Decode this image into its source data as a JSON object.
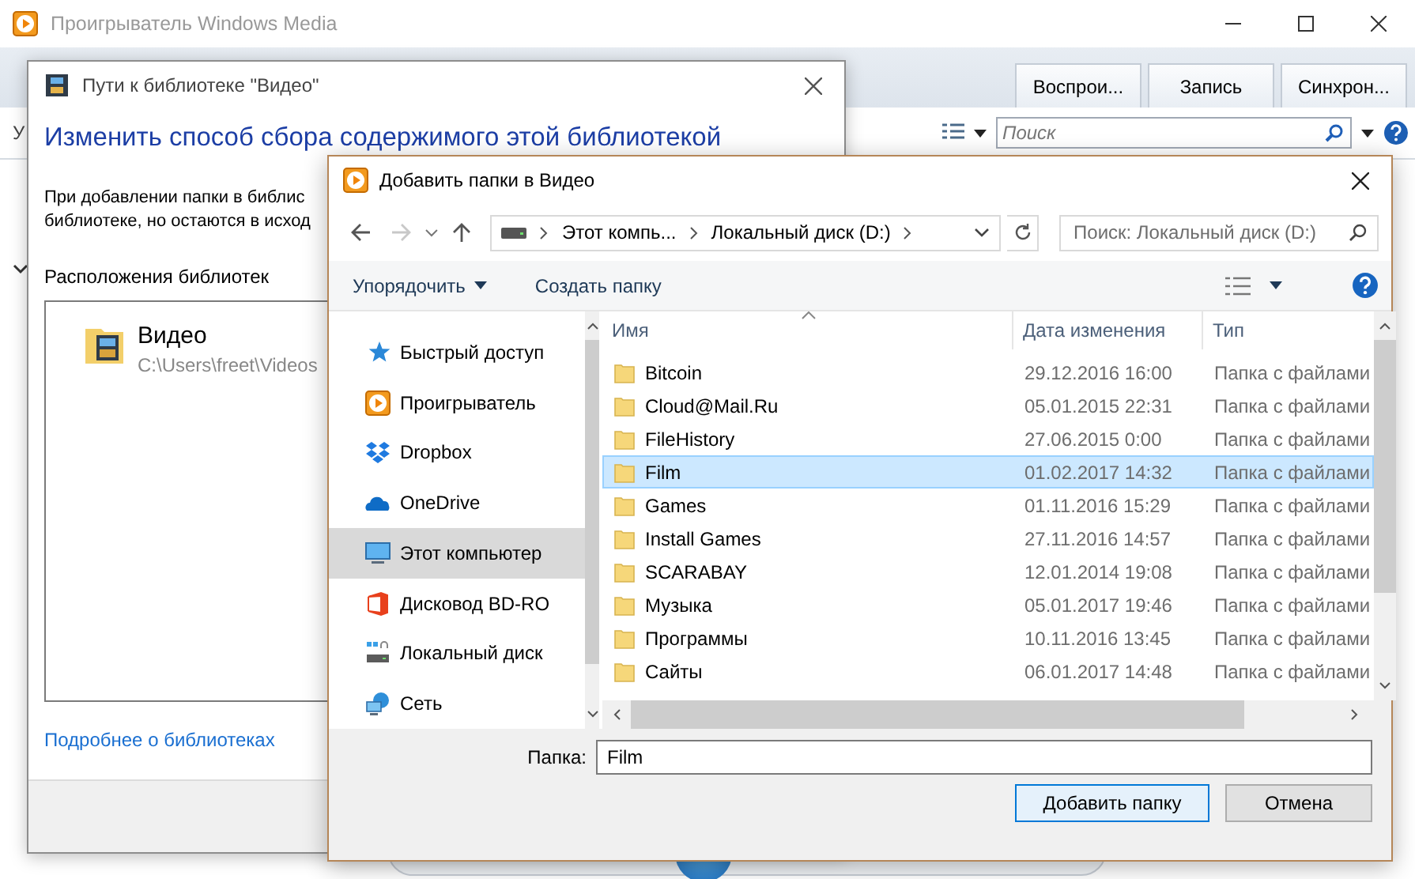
{
  "player": {
    "title": "Проигрыватель Windows Media",
    "tabs": [
      {
        "label": "Воспрои...",
        "selected": false
      },
      {
        "label": "Запись",
        "selected": false
      },
      {
        "label": "Синхрон...",
        "selected": false
      }
    ],
    "toolbar_fragment": "У",
    "search": {
      "placeholder": "Поиск"
    }
  },
  "library_dialog": {
    "title": "Пути к библиотеке \"Видео\"",
    "heading": "Изменить способ сбора содержимого этой библиотекой",
    "description_lines": [
      "При добавлении папки в библис",
      "библиотеке, но остаются в исход"
    ],
    "locations_label": "Расположения библиотек",
    "locations": [
      {
        "name": "Видео",
        "path": "C:\\Users\\freet\\Videos"
      }
    ],
    "link": "Подробнее о библиотеках"
  },
  "add_dialog": {
    "title": "Добавить папки в Видео",
    "breadcrumbs": [
      "Этот компь...",
      "Локальный диск (D:)"
    ],
    "search": {
      "placeholder": "Поиск: Локальный диск (D:)"
    },
    "toolbar": [
      {
        "label": "Упорядочить",
        "kind": "menu"
      },
      {
        "label": "Создать папку",
        "kind": "button"
      }
    ],
    "nav_items": [
      {
        "label": "Быстрый доступ",
        "kind": "quick-access",
        "selected": false
      },
      {
        "label": "Проигрыватель",
        "kind": "player",
        "selected": false
      },
      {
        "label": "Dropbox",
        "kind": "dropbox",
        "selected": false
      },
      {
        "label": "OneDrive",
        "kind": "onedrive",
        "selected": false
      },
      {
        "label": "Этот компьютер",
        "kind": "computer",
        "selected": true
      },
      {
        "label": "Дисковод BD-RO",
        "kind": "disc",
        "selected": false
      },
      {
        "label": "Локальный диск",
        "kind": "drive",
        "selected": false
      },
      {
        "label": "Сеть",
        "kind": "network",
        "selected": false
      }
    ],
    "columns": [
      "Имя",
      "Дата изменения",
      "Тип"
    ],
    "rows": [
      {
        "name": "Bitcoin",
        "modified": "29.12.2016 16:00",
        "type": "Папка с файлами",
        "selected": false
      },
      {
        "name": "Cloud@Mail.Ru",
        "modified": "05.01.2015 22:31",
        "type": "Папка с файлами",
        "selected": false
      },
      {
        "name": "FileHistory",
        "modified": "27.06.2015 0:00",
        "type": "Папка с файлами",
        "selected": false
      },
      {
        "name": "Film",
        "modified": "01.02.2017 14:32",
        "type": "Папка с файлами",
        "selected": true
      },
      {
        "name": "Games",
        "modified": "01.11.2016 15:29",
        "type": "Папка с файлами",
        "selected": false
      },
      {
        "name": "Install Games",
        "modified": "27.11.2016 14:57",
        "type": "Папка с файлами",
        "selected": false
      },
      {
        "name": "SCARABAY",
        "modified": "12.01.2014 19:08",
        "type": "Папка с файлами",
        "selected": false
      },
      {
        "name": "Музыка",
        "modified": "05.01.2017 19:46",
        "type": "Папка с файлами",
        "selected": false
      },
      {
        "name": "Программы",
        "modified": "10.11.2016 13:45",
        "type": "Папка с файлами",
        "selected": false
      },
      {
        "name": "Сайты",
        "modified": "06.01.2017 14:48",
        "type": "Папка с файлами",
        "selected": false
      }
    ],
    "folder_label": "Папка:",
    "folder_value": "Film",
    "buttons": [
      {
        "label": "Добавить папку",
        "kind": "default"
      },
      {
        "label": "Отмена",
        "kind": "normal"
      }
    ]
  }
}
